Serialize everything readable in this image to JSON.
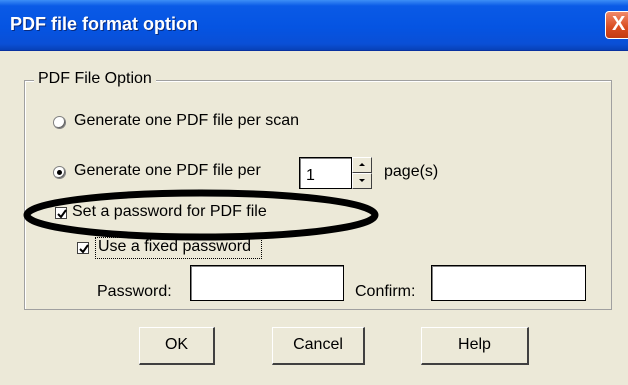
{
  "window": {
    "title": "PDF file format option",
    "close_label": "X"
  },
  "group": {
    "legend": "PDF File Option",
    "radio_per_scan": {
      "label": "Generate one PDF file per scan",
      "selected": false
    },
    "radio_per_pages": {
      "label": "Generate one PDF file per",
      "selected": true
    },
    "pages_value": "1",
    "pages_suffix": "page(s)",
    "set_password": {
      "label": "Set a password for PDF file",
      "checked": true
    },
    "fixed_password": {
      "label": "Use a fixed password",
      "checked": true
    },
    "password_label": "Password:",
    "password_value": "",
    "confirm_label": "Confirm:",
    "confirm_value": ""
  },
  "buttons": {
    "ok": "OK",
    "cancel": "Cancel",
    "help": "Help"
  },
  "colors": {
    "titlebar": "#0554e2",
    "dialog_bg": "#ece9d8",
    "close": "#d94b1f"
  }
}
